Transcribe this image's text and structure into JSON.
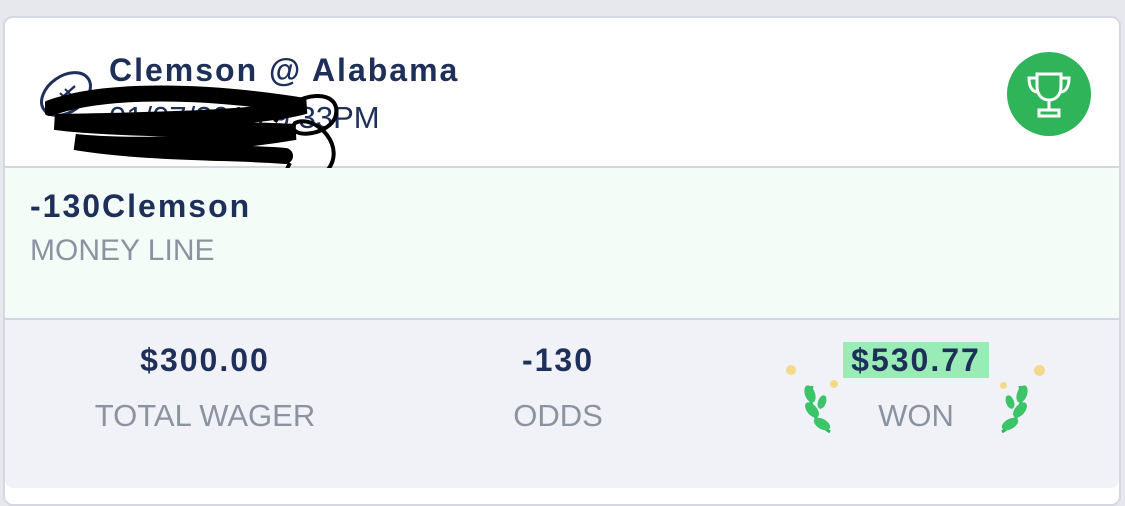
{
  "bet": {
    "matchup": "Clemson @ Alabama",
    "datetime": "01/07/2019 9:33PM",
    "pick_odds": "-130",
    "pick_team": "Clemson",
    "bet_type": "MONEY LINE"
  },
  "stats": {
    "wager_value": "$300.00",
    "wager_label": "TOTAL WAGER",
    "odds_value": "-130",
    "odds_label": "ODDS",
    "won_value": "$530.77",
    "won_label": "WON"
  },
  "icons": {
    "sport": "football-icon",
    "status": "trophy-icon"
  },
  "colors": {
    "text_dark": "#1e2f5a",
    "text_muted": "#8c93a0",
    "win_green": "#2fb45a",
    "won_highlight": "#9aecb7"
  }
}
